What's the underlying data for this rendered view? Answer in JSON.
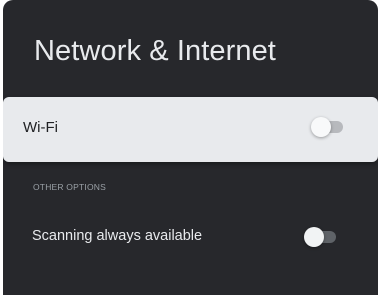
{
  "page": {
    "title": "Network & Internet"
  },
  "wifi": {
    "label": "Wi-Fi",
    "toggle_on": false
  },
  "other_options": {
    "header": "OTHER OPTIONS",
    "scanning": {
      "label": "Scanning always available",
      "toggle_on": false
    }
  },
  "colors": {
    "panel_background": "#27282c",
    "focused_row_background": "#e8eaed",
    "primary_text": "#e8eaed",
    "secondary_text": "#9aa0a6"
  }
}
